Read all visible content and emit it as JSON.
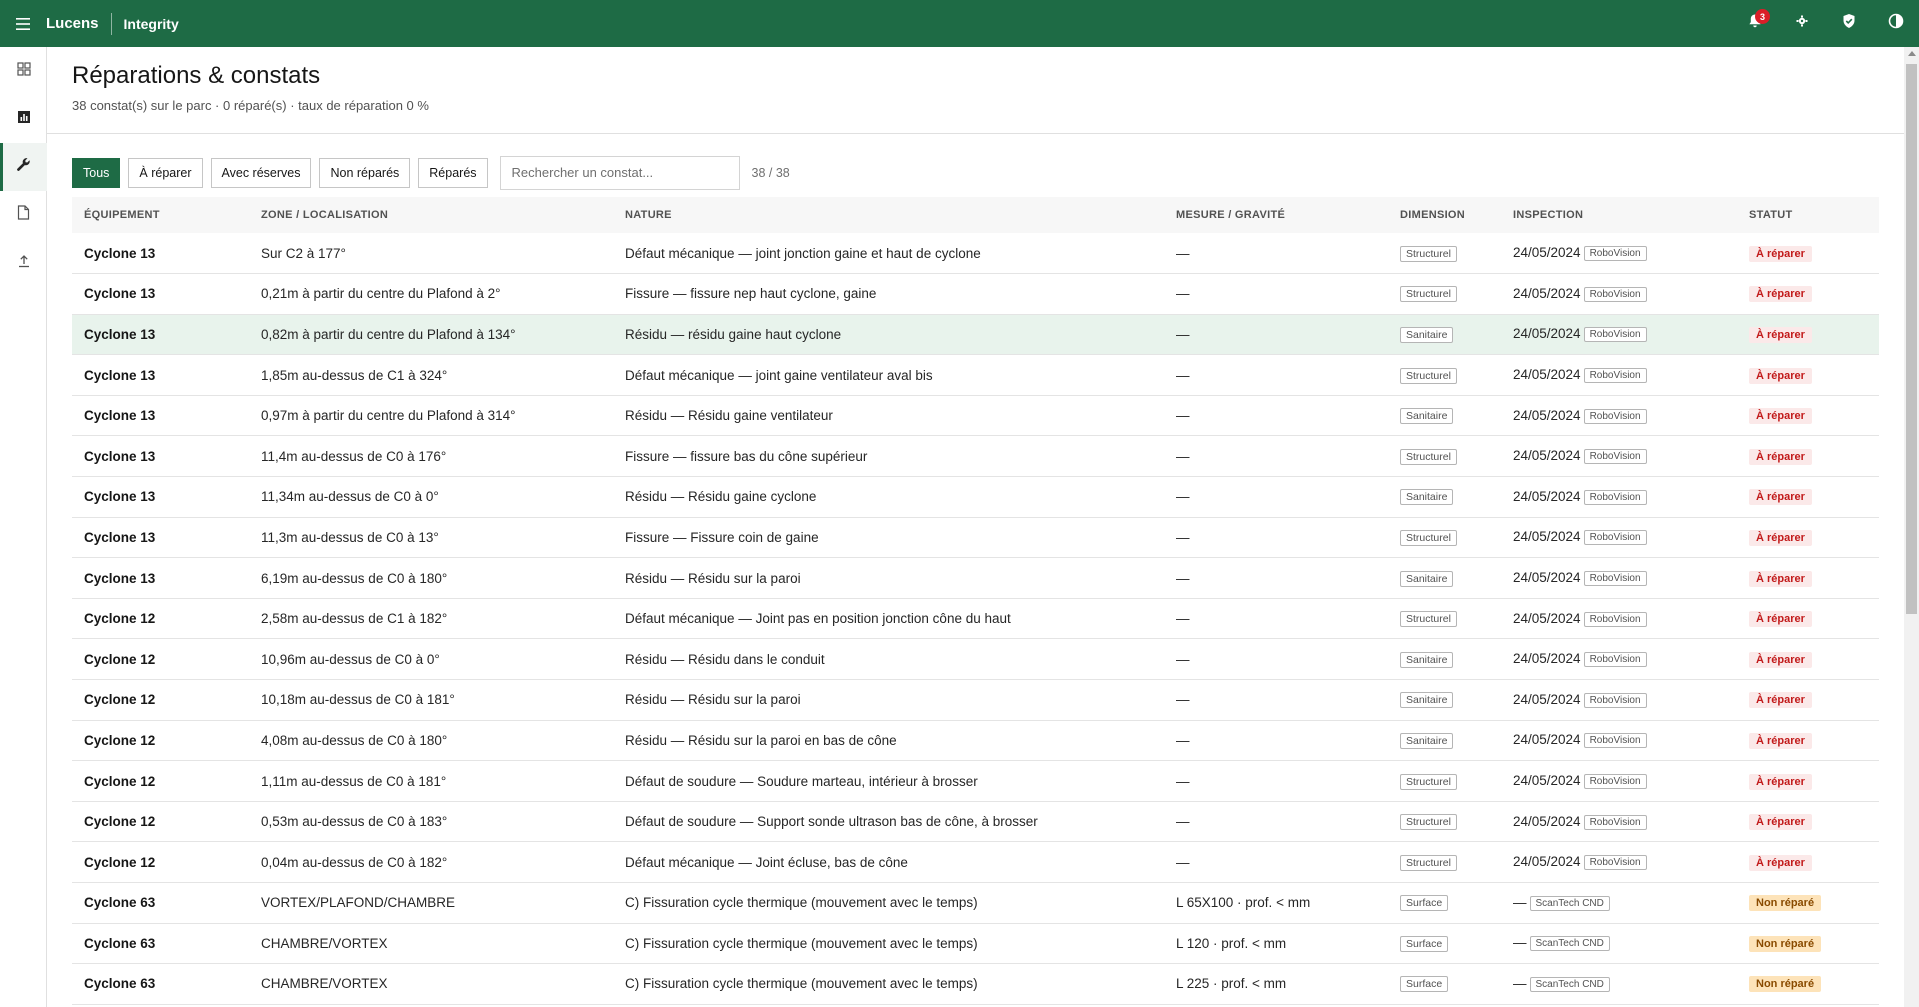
{
  "app": {
    "brand": "Lucens",
    "product": "Integrity",
    "notification_count": "3",
    "accent": "#1e6b45"
  },
  "nav": [
    {
      "icon": "dashboard-grid-icon"
    },
    {
      "icon": "chart-icon"
    },
    {
      "icon": "wrench-icon",
      "active": true
    },
    {
      "icon": "document-icon"
    },
    {
      "icon": "upload-icon"
    }
  ],
  "page": {
    "title": "Réparations & constats",
    "subtitle": "38 constat(s) sur le parc · 0 réparé(s) · taux de réparation 0 %"
  },
  "filters": {
    "buttons": [
      "Tous",
      "À réparer",
      "Avec réserves",
      "Non réparés",
      "Réparés"
    ],
    "active": "Tous",
    "search_placeholder": "Rechercher un constat...",
    "search_value": "",
    "count": "38 / 38"
  },
  "table": {
    "columns": [
      "ÉQUIPEMENT",
      "ZONE / LOCALISATION",
      "NATURE",
      "MESURE / GRAVITÉ",
      "DIMENSION",
      "INSPECTION",
      "STATUT"
    ],
    "rows": [
      {
        "eq": "Cyclone 13",
        "zone": "Sur C2 à 177°",
        "nature": "Défaut mécanique — joint jonction gaine et haut de cyclone",
        "mesure": "—",
        "dim": "Structurel",
        "date": "24/05/2024",
        "src": "RoboVision",
        "statut": "À réparer",
        "tone": "red"
      },
      {
        "eq": "Cyclone 13",
        "zone": "0,21m à partir du centre du Plafond à 2°",
        "nature": "Fissure — fissure nep haut cyclone, gaine",
        "mesure": "—",
        "dim": "Structurel",
        "date": "24/05/2024",
        "src": "RoboVision",
        "statut": "À réparer",
        "tone": "red"
      },
      {
        "eq": "Cyclone 13",
        "zone": "0,82m à partir du centre du Plafond à 134°",
        "nature": "Résidu — résidu gaine haut cyclone",
        "mesure": "—",
        "dim": "Sanitaire",
        "date": "24/05/2024",
        "src": "RoboVision",
        "statut": "À réparer",
        "tone": "red",
        "highlight": true
      },
      {
        "eq": "Cyclone 13",
        "zone": "1,85m au-dessus de C1 à 324°",
        "nature": "Défaut mécanique — joint gaine ventilateur aval bis",
        "mesure": "—",
        "dim": "Structurel",
        "date": "24/05/2024",
        "src": "RoboVision",
        "statut": "À réparer",
        "tone": "red"
      },
      {
        "eq": "Cyclone 13",
        "zone": "0,97m à partir du centre du Plafond à 314°",
        "nature": "Résidu — Résidu gaine ventilateur",
        "mesure": "—",
        "dim": "Sanitaire",
        "date": "24/05/2024",
        "src": "RoboVision",
        "statut": "À réparer",
        "tone": "red"
      },
      {
        "eq": "Cyclone 13",
        "zone": "11,4m au-dessus de C0 à 176°",
        "nature": "Fissure — fissure bas du cône supérieur",
        "mesure": "—",
        "dim": "Structurel",
        "date": "24/05/2024",
        "src": "RoboVision",
        "statut": "À réparer",
        "tone": "red"
      },
      {
        "eq": "Cyclone 13",
        "zone": "11,34m au-dessus de C0 à 0°",
        "nature": "Résidu — Résidu gaine cyclone",
        "mesure": "—",
        "dim": "Sanitaire",
        "date": "24/05/2024",
        "src": "RoboVision",
        "statut": "À réparer",
        "tone": "red"
      },
      {
        "eq": "Cyclone 13",
        "zone": "11,3m au-dessus de C0 à 13°",
        "nature": "Fissure — Fissure coin de gaine",
        "mesure": "—",
        "dim": "Structurel",
        "date": "24/05/2024",
        "src": "RoboVision",
        "statut": "À réparer",
        "tone": "red"
      },
      {
        "eq": "Cyclone 13",
        "zone": "6,19m au-dessus de C0 à 180°",
        "nature": "Résidu — Résidu sur la paroi",
        "mesure": "—",
        "dim": "Sanitaire",
        "date": "24/05/2024",
        "src": "RoboVision",
        "statut": "À réparer",
        "tone": "red"
      },
      {
        "eq": "Cyclone 12",
        "zone": "2,58m au-dessus de C1 à 182°",
        "nature": "Défaut mécanique — Joint pas en position jonction cône du haut",
        "mesure": "—",
        "dim": "Structurel",
        "date": "24/05/2024",
        "src": "RoboVision",
        "statut": "À réparer",
        "tone": "red"
      },
      {
        "eq": "Cyclone 12",
        "zone": "10,96m au-dessus de C0 à 0°",
        "nature": "Résidu — Résidu dans le conduit",
        "mesure": "—",
        "dim": "Sanitaire",
        "date": "24/05/2024",
        "src": "RoboVision",
        "statut": "À réparer",
        "tone": "red"
      },
      {
        "eq": "Cyclone 12",
        "zone": "10,18m au-dessus de C0 à 181°",
        "nature": "Résidu — Résidu sur la paroi",
        "mesure": "—",
        "dim": "Sanitaire",
        "date": "24/05/2024",
        "src": "RoboVision",
        "statut": "À réparer",
        "tone": "red"
      },
      {
        "eq": "Cyclone 12",
        "zone": "4,08m au-dessus de C0 à 180°",
        "nature": "Résidu — Résidu sur la paroi en bas de cône",
        "mesure": "—",
        "dim": "Sanitaire",
        "date": "24/05/2024",
        "src": "RoboVision",
        "statut": "À réparer",
        "tone": "red"
      },
      {
        "eq": "Cyclone 12",
        "zone": "1,11m au-dessus de C0 à 181°",
        "nature": "Défaut de soudure — Soudure marteau, intérieur à brosser",
        "mesure": "—",
        "dim": "Structurel",
        "date": "24/05/2024",
        "src": "RoboVision",
        "statut": "À réparer",
        "tone": "red"
      },
      {
        "eq": "Cyclone 12",
        "zone": "0,53m au-dessus de C0 à 183°",
        "nature": "Défaut de soudure — Support sonde ultrason bas de cône, à brosser",
        "mesure": "—",
        "dim": "Structurel",
        "date": "24/05/2024",
        "src": "RoboVision",
        "statut": "À réparer",
        "tone": "red"
      },
      {
        "eq": "Cyclone 12",
        "zone": "0,04m au-dessus de C0 à 182°",
        "nature": "Défaut mécanique — Joint écluse, bas de cône",
        "mesure": "—",
        "dim": "Structurel",
        "date": "24/05/2024",
        "src": "RoboVision",
        "statut": "À réparer",
        "tone": "red"
      },
      {
        "eq": "Cyclone 63",
        "zone": "VORTEX/PLAFOND/CHAMBRE",
        "nature": "C) Fissuration cycle thermique (mouvement avec le temps)",
        "mesure": "L 65X100 · prof. < mm",
        "dim": "Surface",
        "date": "—",
        "src": "ScanTech CND",
        "statut": "Non réparé",
        "tone": "orange"
      },
      {
        "eq": "Cyclone 63",
        "zone": "CHAMBRE/VORTEX",
        "nature": "C) Fissuration cycle thermique (mouvement avec le temps)",
        "mesure": "L 120 · prof. < mm",
        "dim": "Surface",
        "date": "—",
        "src": "ScanTech CND",
        "statut": "Non réparé",
        "tone": "orange"
      },
      {
        "eq": "Cyclone 63",
        "zone": "CHAMBRE/VORTEX",
        "nature": "C) Fissuration cycle thermique (mouvement avec le temps)",
        "mesure": "L 225 · prof. < mm",
        "dim": "Surface",
        "date": "—",
        "src": "ScanTech CND",
        "statut": "Non réparé",
        "tone": "orange"
      }
    ]
  }
}
